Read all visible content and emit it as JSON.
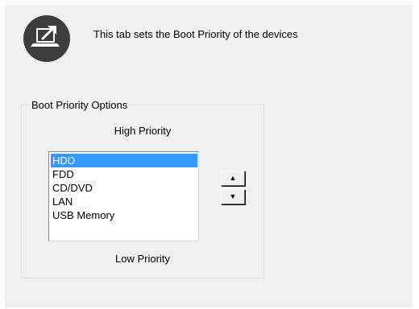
{
  "header": {
    "description": "This tab sets the Boot Priority of the devices",
    "icon": "laptop-share-icon"
  },
  "group": {
    "title": "Boot Priority Options",
    "high_label": "High Priority",
    "low_label": "Low Priority"
  },
  "boot_list": {
    "items": [
      {
        "label": "HDD",
        "selected": true
      },
      {
        "label": "FDD",
        "selected": false
      },
      {
        "label": "CD/DVD",
        "selected": false
      },
      {
        "label": "LAN",
        "selected": false
      },
      {
        "label": "USB Memory",
        "selected": false
      }
    ],
    "selection_color": "#3399ff"
  },
  "buttons": {
    "move_up_glyph": "▲",
    "move_down_glyph": "▼"
  }
}
